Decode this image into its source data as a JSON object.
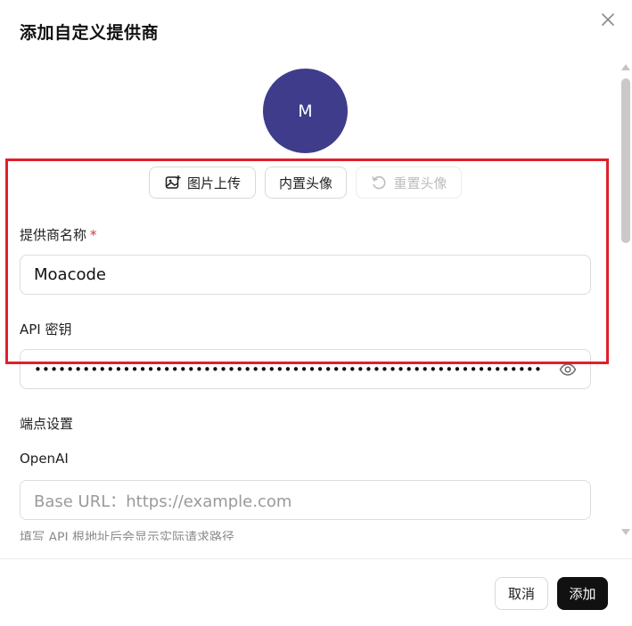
{
  "dialog": {
    "title": "添加自定义提供商",
    "close_icon": "close-icon"
  },
  "avatar": {
    "letter": "M",
    "color": "#3f3c8c"
  },
  "avatar_buttons": {
    "upload": {
      "label": "图片上传",
      "icon": "image-upload-icon"
    },
    "builtin": {
      "label": "内置头像"
    },
    "reset": {
      "label": "重置头像",
      "icon": "reset-icon",
      "disabled": true
    }
  },
  "form": {
    "provider_name": {
      "label": "提供商名称",
      "required_mark": "*",
      "value": "Moacode"
    },
    "api_key": {
      "label": "API 密钥",
      "masked_value": "•••••••••••••••••••••••••••••••••••••••••••••••••••••••••••••••",
      "toggle_icon": "eye-icon"
    },
    "endpoint": {
      "section_label": "端点设置",
      "openai_label": "OpenAI",
      "base_url_placeholder": "Base URL：https://example.com",
      "hint": "填写 API 根地址后会显示实际请求路径"
    }
  },
  "footer": {
    "cancel_label": "取消",
    "add_label": "添加"
  },
  "colors": {
    "highlight": "#e0202a",
    "primary": "#111111",
    "required": "#e03131"
  }
}
